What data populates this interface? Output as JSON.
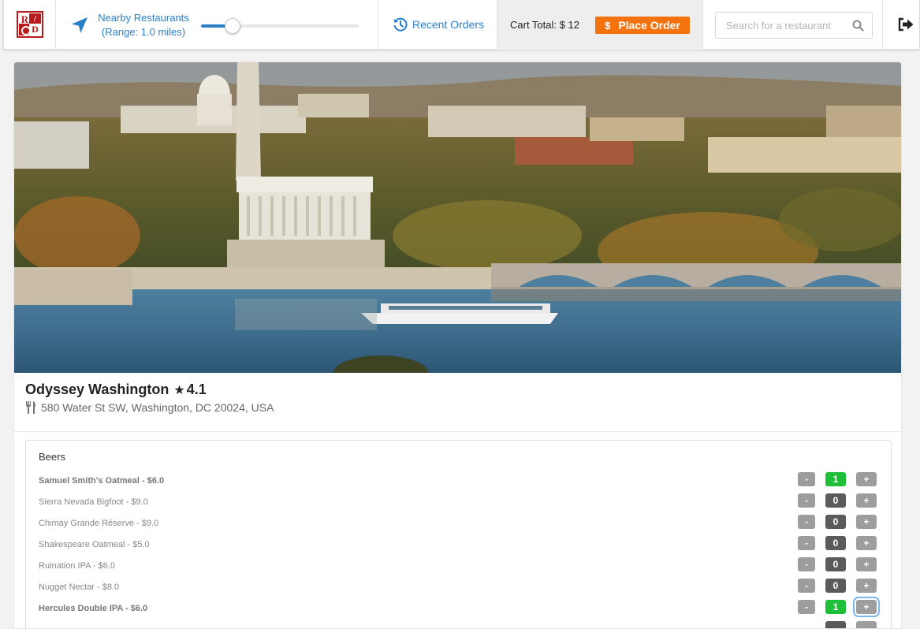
{
  "nav": {
    "nearby_line1": "Nearby Restaurants",
    "nearby_line2": "(Range: 1.0 miles)",
    "range_fraction": 0.2,
    "recent_orders": "Recent Orders",
    "cart_total": "Cart Total: $ 12",
    "place_order_symbol": "$",
    "place_order": "Place Order",
    "search_placeholder": "Search for a restaurant"
  },
  "restaurant": {
    "name": "Odyssey Washington",
    "star": "★",
    "rating": "4.1",
    "address": "580 Water St SW, Washington, DC 20024, USA"
  },
  "menu": {
    "category": "Beers",
    "items": [
      {
        "label": "Samuel Smith's Oatmeal - $6.0",
        "minus": "-",
        "qty": "1",
        "plus": "+"
      },
      {
        "label": "Sierra Nevada Bigfoot - $9.0",
        "minus": "-",
        "qty": "0",
        "plus": "+"
      },
      {
        "label": "Chimay Grande Réserve - $9.0",
        "minus": "-",
        "qty": "0",
        "plus": "+"
      },
      {
        "label": "Shakespeare Oatmeal - $5.0",
        "minus": "-",
        "qty": "0",
        "plus": "+"
      },
      {
        "label": "Ruination IPA - $6.0",
        "minus": "-",
        "qty": "0",
        "plus": "+"
      },
      {
        "label": "Nugget Nectar - $8.0",
        "minus": "-",
        "qty": "0",
        "plus": "+"
      },
      {
        "label": "Hercules Double IPA - $6.0",
        "minus": "-",
        "qty": "1",
        "plus": "+"
      }
    ]
  },
  "colors": {
    "accent_blue": "#2a7fc9",
    "order_orange": "#f4730f",
    "qty_selected_green": "#1fbf3a",
    "qty_zero_gray": "#5b5b5b"
  },
  "icons": {
    "logo": "red-square-logo",
    "nearby": "location-arrow-icon",
    "orders": "history-icon",
    "search": "search-icon",
    "logout": "logout-icon",
    "address": "utensils-icon"
  }
}
